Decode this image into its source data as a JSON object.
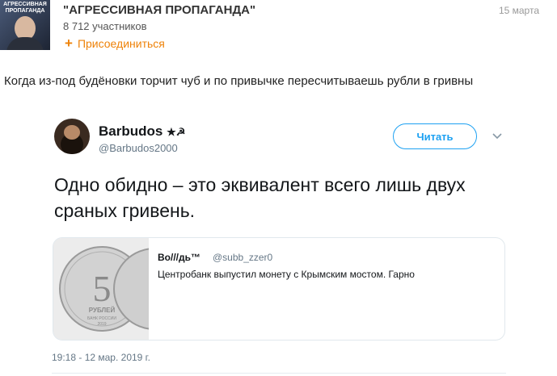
{
  "group": {
    "avatar_text": "АГРЕССИВНАЯ ПРОПАГАНДА",
    "title": "\"АГРЕССИВНАЯ ПРОПАГАНДА\"",
    "members": "8 712 участников",
    "join_label": "Присоединиться",
    "date": "15 марта"
  },
  "post": {
    "caption": "Когда из-под будёновки торчит чуб и по привычке пересчитываешь рубли в гривны"
  },
  "tweet": {
    "name": "Barbudos",
    "name_suffix": "★☭",
    "handle": "@Barbudos2000",
    "follow_label": "Читать",
    "text": "Одно обидно – это эквивалент всего лишь двух сраных гривень.",
    "timestamp": "19:18 - 12 мар. 2019 г."
  },
  "quote": {
    "name": "Во///дь™",
    "handle": "@subb_zzer0",
    "text": "Центробанк выпустил монету с Крымским мостом. Гарно",
    "coin_denomination": "5",
    "coin_word": "РУБЛЕЙ",
    "coin_bank": "БАНК РОССИИ",
    "coin_year": "2019"
  },
  "colors": {
    "accent_orange": "#ee8208",
    "twitter_blue": "#1da1f2",
    "muted_gray": "#657786"
  }
}
